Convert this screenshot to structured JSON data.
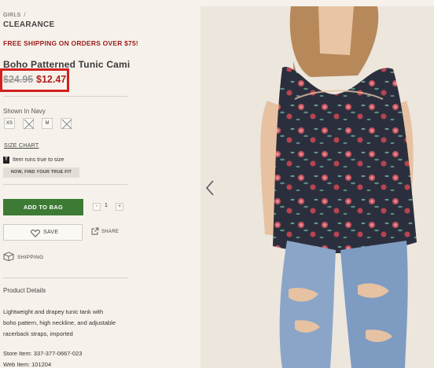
{
  "breadcrumb": {
    "parent": "GIRLS",
    "separator": "/",
    "current": "CLEARANCE"
  },
  "promo": "FREE SHIPPING ON ORDERS OVER $75!",
  "product": {
    "title": "Boho Patterned Tunic Cami",
    "original_price": "$24.95",
    "sale_price": "$12.47"
  },
  "colors": {
    "accent_green": "#3d7a34",
    "sale_red": "#b01f1f",
    "highlight_red": "#d41f1f"
  },
  "variant": {
    "label": "Shown In Navy"
  },
  "sizes": [
    {
      "label": "XS",
      "available": true
    },
    {
      "label": "",
      "available": false
    },
    {
      "label": "M",
      "available": true
    },
    {
      "label": "",
      "available": false
    }
  ],
  "size_chart_label": "SIZE CHART",
  "fit": {
    "icon": "T",
    "text": "Item runs true to size",
    "button": "NOW, FIND YOUR TRUE FIT"
  },
  "actions": {
    "add_to_bag": "ADD TO BAG",
    "quantity": "1",
    "minus": "-",
    "plus": "+",
    "save": "SAVE",
    "share": "SHARE",
    "shipping": "SHIPPING"
  },
  "details": {
    "heading": "Product Details",
    "line1": "Lightweight and drapey tunic tank with",
    "line2": "boho pattern, high neckline, and adjustable",
    "line3": "racerback straps, imported",
    "store_item": "Store Item: 337-377-0667-023",
    "web_item": "Web Item: 101204"
  },
  "icons": [
    "heart-icon",
    "share-icon",
    "shipping-box-icon",
    "chevron-left-icon",
    "unavailable-x-icon"
  ]
}
